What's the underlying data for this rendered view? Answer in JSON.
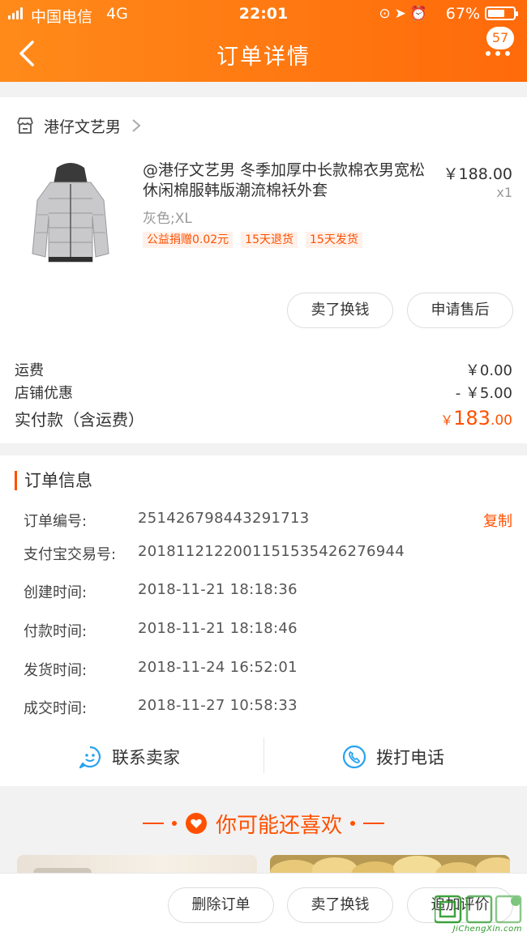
{
  "status_bar": {
    "carrier": "中国电信",
    "network": "4G",
    "time": "22:01",
    "battery": "67%",
    "battery_level": 0.67
  },
  "header": {
    "title": "订单详情",
    "badge_count": "57",
    "back_icon": "back-chevron-icon",
    "more_icon": "more-dots-icon"
  },
  "shop": {
    "name": "港仔文艺男",
    "icon": "store-icon"
  },
  "product": {
    "title": "@港仔文艺男 冬季加厚中长款棉衣男宽松休闲棉服韩版潮流棉袄外套",
    "price": "￥188.00",
    "quantity": "x1",
    "sku": "灰色;XL",
    "tags": [
      "公益捐赠0.02元",
      "15天退货",
      "15天发货"
    ]
  },
  "item_actions": {
    "sell": "卖了换钱",
    "after_sale": "申请售后"
  },
  "fees": {
    "shipping_label": "运费",
    "shipping_value": "￥0.00",
    "discount_label": "店铺优惠",
    "discount_value": "- ￥5.00",
    "total_label": "实付款（含运费）",
    "total_currency": "￥",
    "total_int": "183",
    "total_dec": ".00"
  },
  "order_info": {
    "title": "订单信息",
    "copy_label": "复制",
    "rows": [
      {
        "label": "订单编号:",
        "value": "251426798443291713"
      },
      {
        "label": "支付宝交易号:",
        "value": "2018112122001151535426276944"
      },
      {
        "label": "创建时间:",
        "value": "2018-11-21 18:18:36"
      },
      {
        "label": "付款时间:",
        "value": "2018-11-21 18:18:46"
      },
      {
        "label": "发货时间:",
        "value": "2018-11-24 16:52:01"
      },
      {
        "label": "成交时间:",
        "value": "2018-11-27 10:58:33"
      }
    ]
  },
  "contact": {
    "seller": "联系卖家",
    "phone": "拨打电话"
  },
  "recommend": {
    "title": "你可能还喜欢"
  },
  "bottom_bar": {
    "delete": "删除订单",
    "sell": "卖了换钱",
    "review": "追加评价"
  },
  "watermark": {
    "text": "JiChengXin.com"
  },
  "colors": {
    "accent": "#ff5000",
    "header_start": "#ff8a1a",
    "header_end": "#ff6a0a"
  }
}
